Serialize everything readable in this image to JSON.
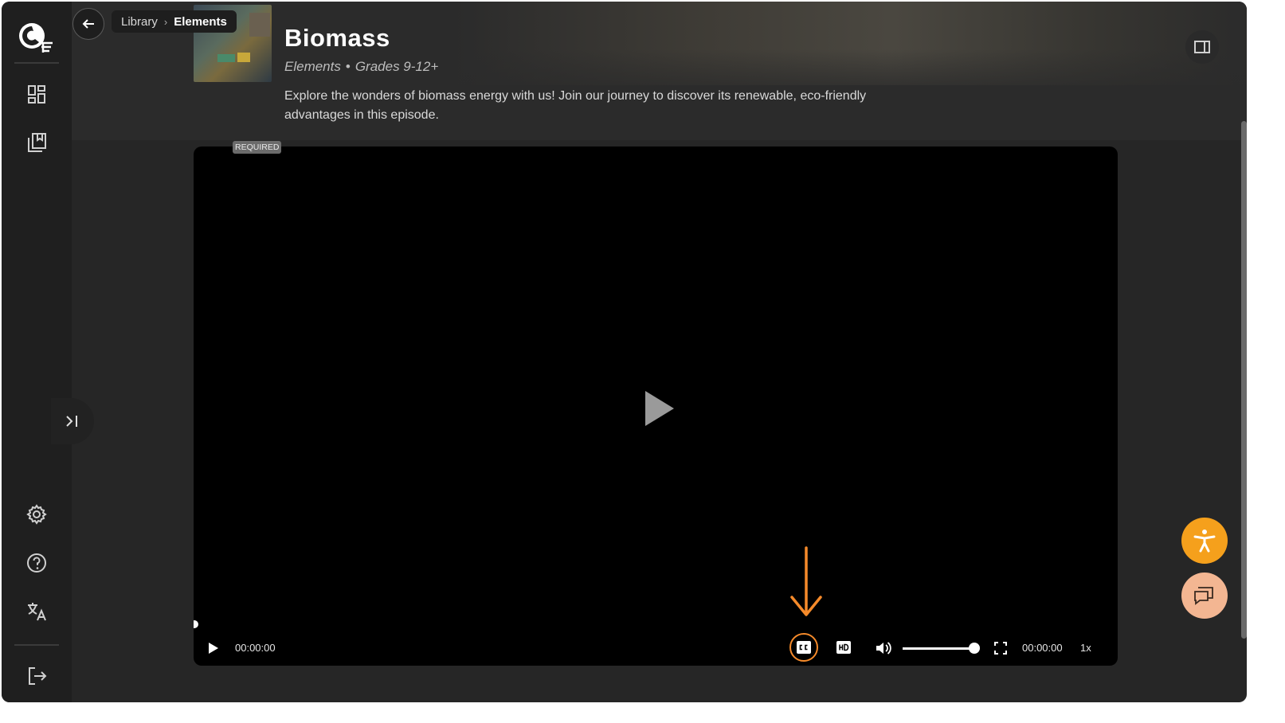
{
  "breadcrumb": {
    "items": [
      "Library",
      "Elements"
    ]
  },
  "episode": {
    "title": "Biomass",
    "series": "Elements",
    "grades": "Grades 9-12+",
    "separator": "•",
    "description": "Explore the wonders of biomass energy with us! Join our journey to discover its renewable, eco-friendly advantages in this episode."
  },
  "badge": {
    "required": "REQUIRED"
  },
  "player": {
    "current_time": "00:00:00",
    "duration": "00:00:00",
    "speed": "1x",
    "volume_level": 1.0,
    "progress": 0
  },
  "icons": {
    "sidebar": [
      "logo-icon",
      "dashboard-icon",
      "library-icon",
      "settings-icon",
      "help-icon",
      "translate-icon",
      "logout-icon"
    ],
    "controls": [
      "play-icon",
      "cc-icon",
      "hd-icon",
      "volume-icon",
      "fullscreen-icon"
    ],
    "floating": [
      "accessibility-icon",
      "chat-icon"
    ]
  },
  "colors": {
    "accent_orange": "#f58a2a",
    "accessibility_button": "#f5a01c",
    "chat_button": "#f3b692",
    "sidebar_bg": "#1f1f1f",
    "content_bg": "#262626",
    "player_bg": "#000000"
  }
}
